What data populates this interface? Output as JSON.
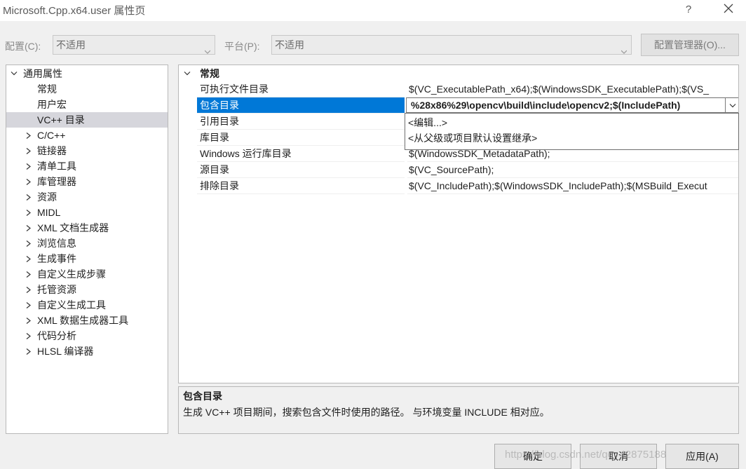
{
  "window": {
    "title": "Microsoft.Cpp.x64.user 属性页",
    "help_label": "?",
    "close_icon": "close-icon"
  },
  "config_bar": {
    "config_label": "配置(C):",
    "config_value": "不适用",
    "platform_label": "平台(P):",
    "platform_value": "不适用",
    "manager_button": "配置管理器(O)..."
  },
  "tree": {
    "root_label": "通用属性",
    "children": [
      "常规",
      "用户宏",
      "VC++ 目录"
    ],
    "selected": "VC++ 目录",
    "groups": [
      "C/C++",
      "链接器",
      "清单工具",
      "库管理器",
      "资源",
      "MIDL",
      "XML 文档生成器",
      "浏览信息",
      "生成事件",
      "自定义生成步骤",
      "托管资源",
      "自定义生成工具",
      "XML 数据生成器工具",
      "代码分析",
      "HLSL 编译器"
    ]
  },
  "grid": {
    "section_title": "常规",
    "rows": [
      {
        "name": "可执行文件目录",
        "value": "$(VC_ExecutablePath_x64);$(WindowsSDK_ExecutablePath);$(VS_"
      },
      {
        "name": "包含目录",
        "value": "%28x86%29\\opencv\\build\\include\\opencv2;$(IncludePath)"
      },
      {
        "name": "引用目录",
        "value": ""
      },
      {
        "name": "库目录",
        "value": ""
      },
      {
        "name": "Windows 运行库目录",
        "value": "$(WindowsSDK_MetadataPath);"
      },
      {
        "name": "源目录",
        "value": "$(VC_SourcePath);"
      },
      {
        "name": "排除目录",
        "value": "$(VC_IncludePath);$(WindowsSDK_IncludePath);$(MSBuild_Execut"
      }
    ],
    "selected_row": "包含目录"
  },
  "dropdown": {
    "items": [
      "<编辑...>",
      "<从父级或项目默认设置继承>"
    ]
  },
  "description": {
    "title": "包含目录",
    "text": "生成 VC++ 项目期间，搜索包含文件时使用的路径。 与环境变量 INCLUDE 相对应。"
  },
  "buttons": {
    "ok": "确定",
    "cancel": "取消",
    "apply": "应用(A)"
  },
  "watermark": "https://blog.csdn.net/qq_42875188"
}
